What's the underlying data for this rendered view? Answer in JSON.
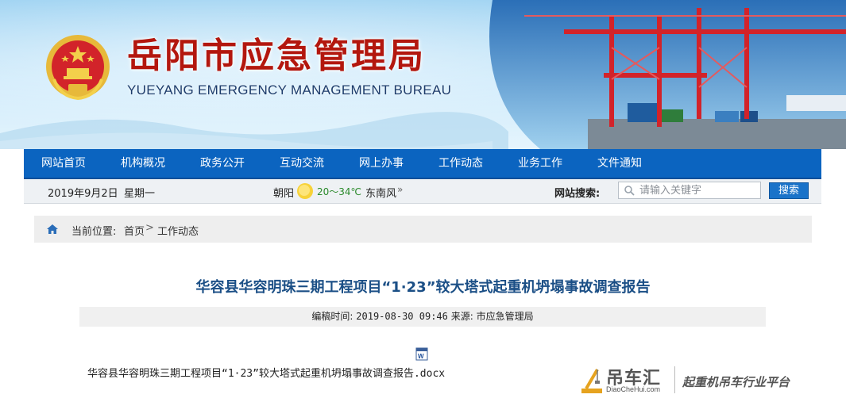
{
  "header": {
    "title_cn": "岳阳市应急管理局",
    "title_en": "YUEYANG EMERGENCY MANAGEMENT BUREAU",
    "emblem_icon": "national-emblem-icon"
  },
  "nav": {
    "items": [
      "网站首页",
      "机构概况",
      "政务公开",
      "互动交流",
      "网上办事",
      "工作动态",
      "业务工作",
      "文件通知"
    ]
  },
  "infobar": {
    "date": "2019年9月2日",
    "weekday": "星期一",
    "city": "朝阳",
    "weather_icon": "sun-icon",
    "temperature": "20～34℃",
    "wind": "东南风",
    "wind_more": "»",
    "search_label": "网站搜索:",
    "search_placeholder": "请输入关键字",
    "search_button": "搜索"
  },
  "breadcrumb": {
    "label": "当前位置:",
    "items": [
      "首页",
      "工作动态"
    ],
    "separator": ">"
  },
  "article": {
    "title": "华容县华容明珠三期工程项目“1·23”较大塔式起重机坍塌事故调查报告",
    "meta_label_time": "编稿时间:",
    "meta_time": "2019-08-30 09:46",
    "meta_label_source": "来源:",
    "meta_source": "市应急管理局",
    "attachment_icon": "word-doc-icon",
    "attachment_name": "华容县华容明珠三期工程项目“1·23”较大塔式起重机坍塌事故调查报告.docx"
  },
  "watermark": {
    "name": "吊车汇",
    "url": "DiaoCheHui.com",
    "slogan": "起重机吊车行业平台"
  },
  "colors": {
    "nav_bg": "#0b64c0",
    "title_red": "#b3170e",
    "article_title": "#1b4f86",
    "crane_red": "#d2232a"
  }
}
